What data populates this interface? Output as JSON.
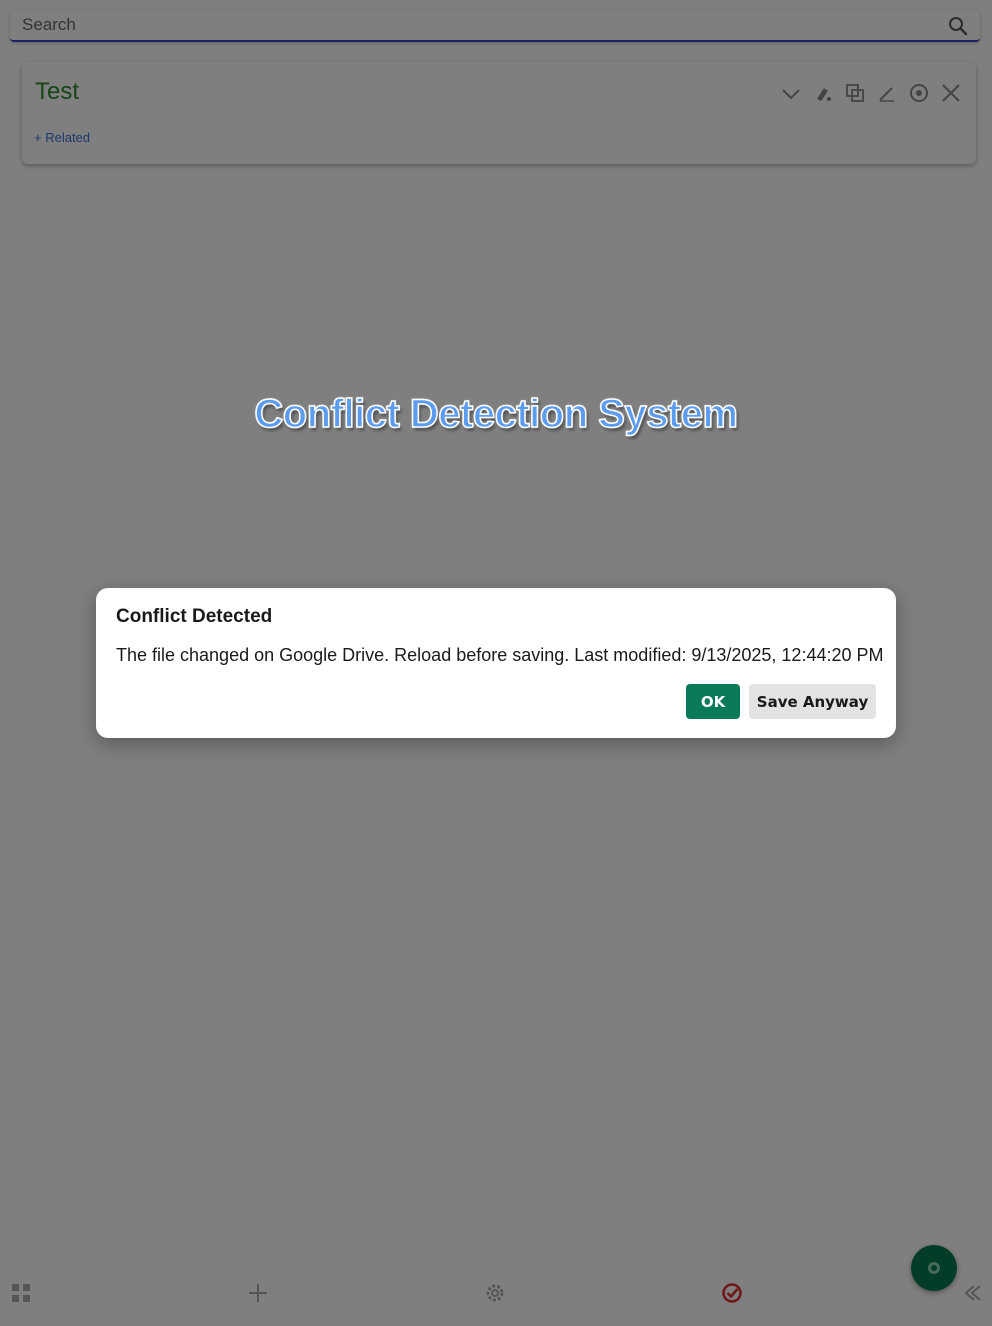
{
  "search": {
    "placeholder": "Search",
    "icon": "search-icon"
  },
  "card": {
    "title": "Test",
    "related_label": "+ Related",
    "tools": [
      "chevron-down-icon",
      "brush-icon",
      "duplicate-icon",
      "pencil-icon",
      "target-icon",
      "close-icon"
    ]
  },
  "bottom_bar": {
    "icons": [
      "grid-icon",
      "plus-icon",
      "gear-icon",
      "check-circle-icon",
      "collapse-icon"
    ]
  },
  "banner": {
    "text": "Conflict Detection System"
  },
  "dialog": {
    "title": "Conflict Detected",
    "message": "The file changed on Google Drive. Reload before saving. Last modified: 9/13/2025, 12:44:20 PM",
    "ok_label": "OK",
    "save_anyway_label": "Save Anyway"
  },
  "colors": {
    "ok_button": "#087a5a",
    "save_button": "#e3e3e3",
    "card_title": "#2e8b2e",
    "banner_text": "#5c9cf0",
    "fab": "#087a4e",
    "check_icon": "#e0282e"
  }
}
